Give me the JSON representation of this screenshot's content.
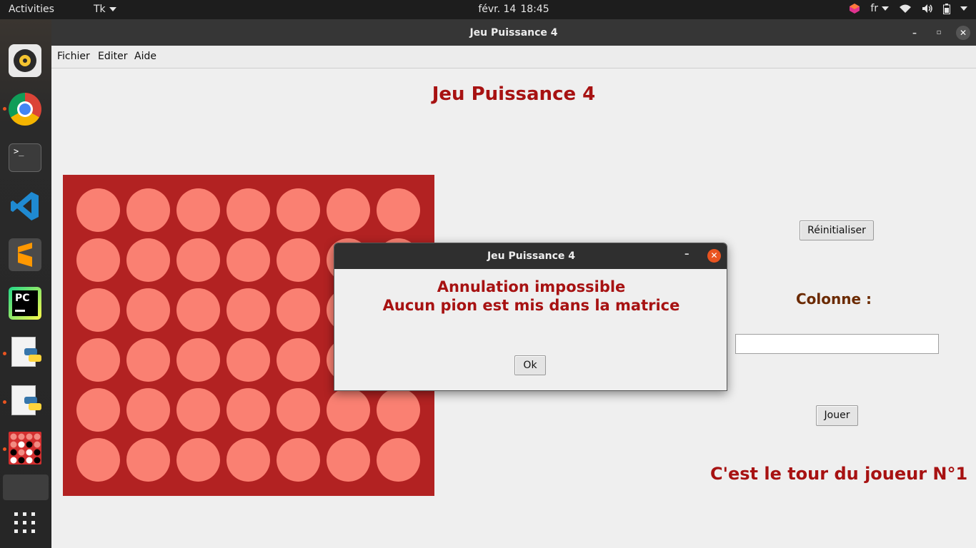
{
  "topbar": {
    "activities": "Activities",
    "app_menu": "Tk",
    "date": "févr. 14",
    "time": "18:45",
    "language": "fr"
  },
  "window": {
    "title": "Jeu Puissance 4",
    "menu": [
      "Fichier",
      "Editer",
      "Aide"
    ]
  },
  "game": {
    "heading": "Jeu Puissance 4",
    "reset_button": "Réinitialiser",
    "column_label": "Colonne :",
    "column_input_value": "",
    "play_button": "Jouer",
    "turn_text": "C'est le tour du joueur N°1",
    "board": {
      "rows": 6,
      "cols": 7
    }
  },
  "dialog": {
    "title": "Jeu Puissance 4",
    "line1": "Annulation impossible",
    "line2": "Aucun pion est mis dans la matrice",
    "ok_button": "Ok"
  },
  "colors": {
    "board": "#b22222",
    "empty_cell": "#fa8072",
    "title_red": "#a71212",
    "label_brown": "#6b2a00",
    "ubuntu_orange": "#e95420"
  },
  "dock": {
    "items": [
      "rhythmbox-icon",
      "chrome-icon",
      "terminal-icon",
      "vscode-icon",
      "sublime-text-icon",
      "pycharm-icon",
      "python-file-icon",
      "python-file-icon",
      "puissance4-app-icon",
      "show-apps-icon"
    ]
  }
}
